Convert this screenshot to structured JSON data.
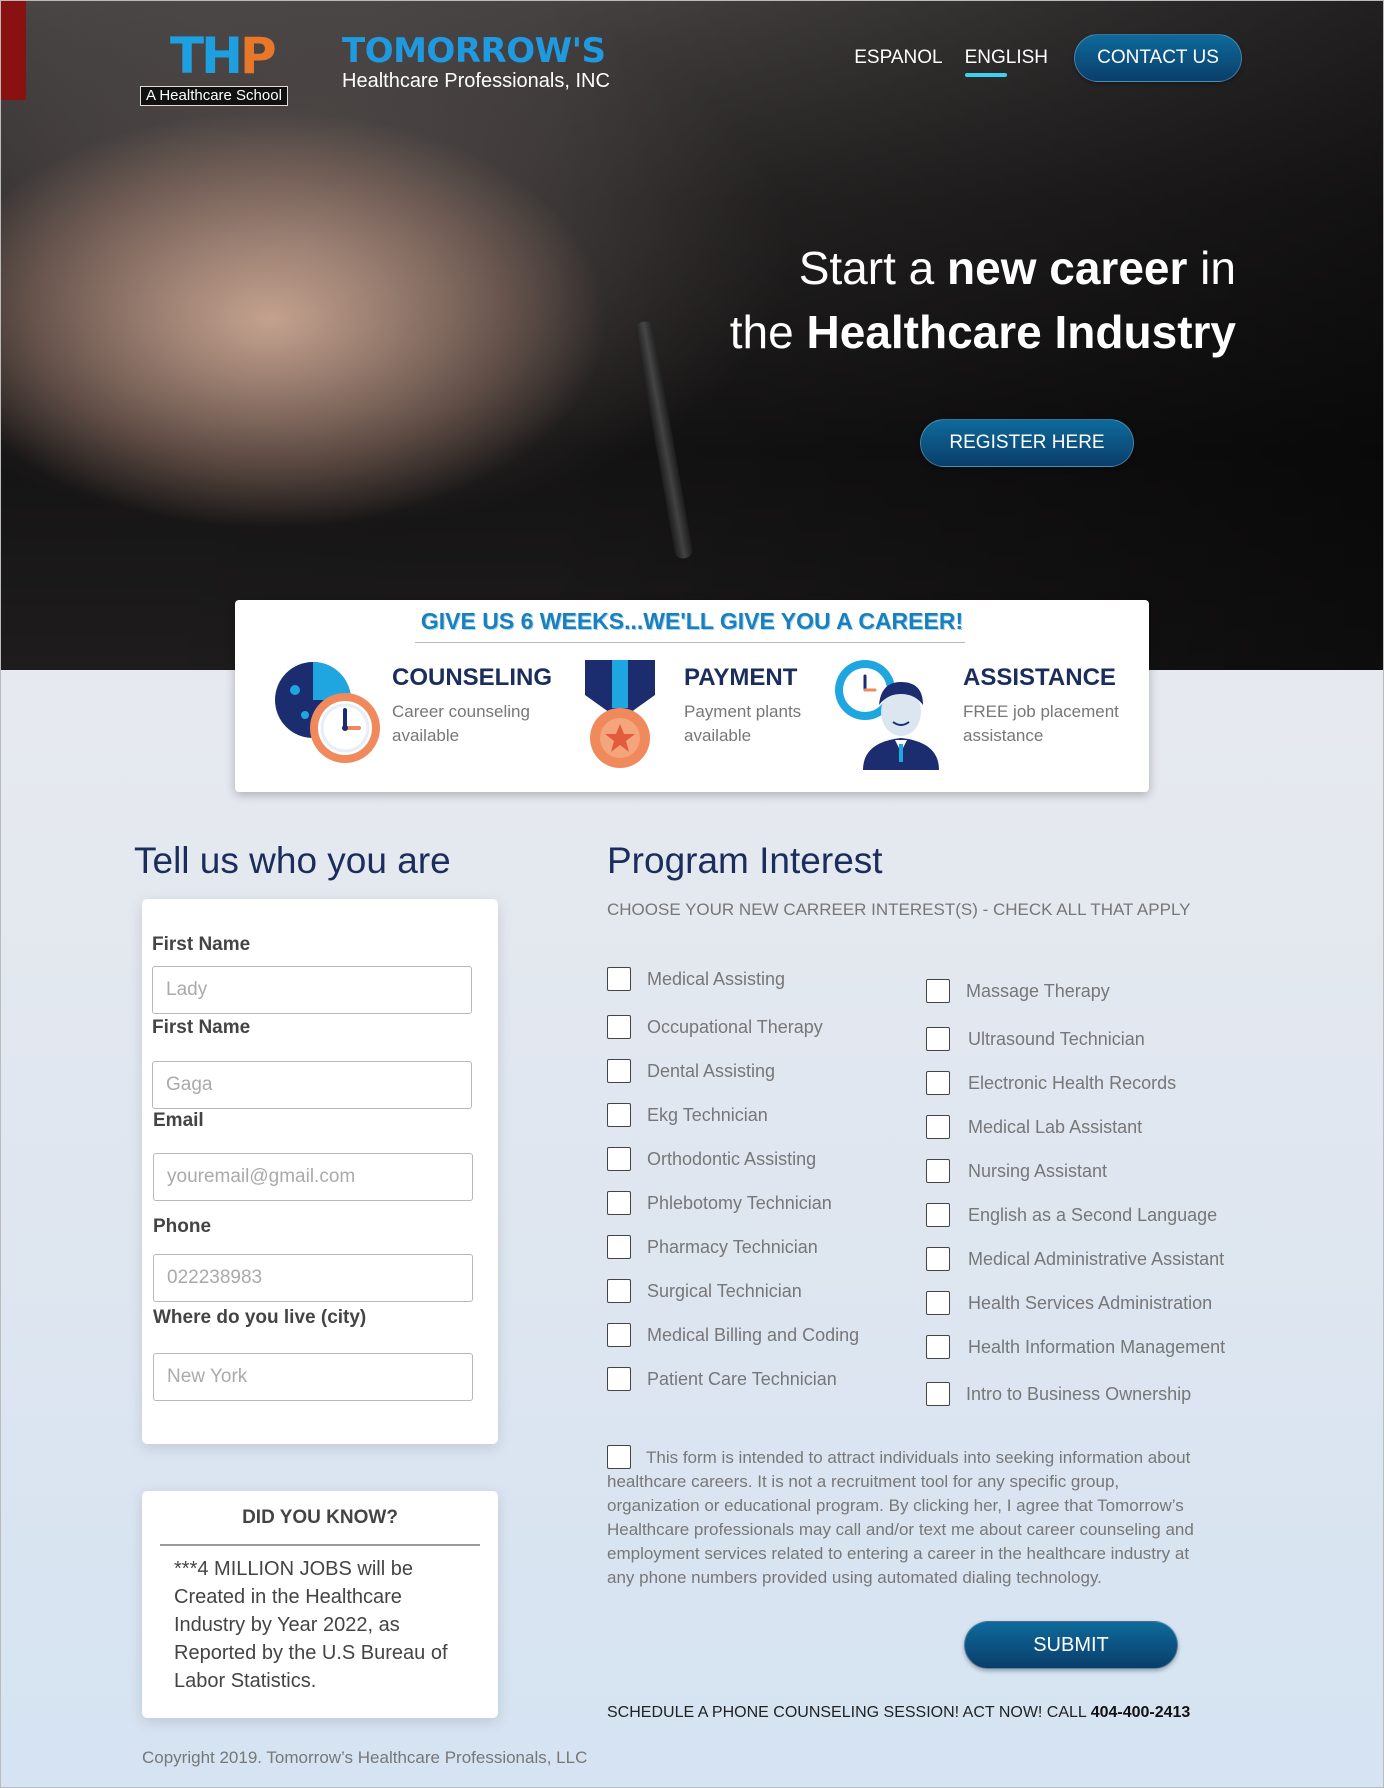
{
  "header": {
    "logo_text": "THP",
    "logo_tagline": "A Healthcare School",
    "brand_name": "TOMORROW'S",
    "brand_sub": "Healthcare Professionals, INC",
    "nav": {
      "espanol": "ESPANOL",
      "english": "ENGLISH",
      "contact": "CONTACT US"
    }
  },
  "hero": {
    "line1_a": "Start a ",
    "line1_b": "new career",
    "line1_c": " in",
    "line2_a": "the ",
    "line2_b": "Healthcare Industry",
    "register": "REGISTER HERE"
  },
  "features": {
    "tagline": "GIVE US 6 WEEKS...WE'LL GIVE YOU A CAREER!",
    "items": [
      {
        "title": "COUNSELING",
        "desc": "Career counseling available",
        "icon": "clock-counseling-icon"
      },
      {
        "title": "PAYMENT",
        "desc": "Payment plants available",
        "icon": "medal-icon"
      },
      {
        "title": "ASSISTANCE",
        "desc": "FREE job placement assistance",
        "icon": "support-agent-icon"
      }
    ]
  },
  "form": {
    "heading": "Tell us who you are",
    "fields": [
      {
        "label": "First Name",
        "placeholder": "Lady"
      },
      {
        "label": "First Name",
        "placeholder": "Gaga"
      },
      {
        "label": "Email",
        "placeholder": "youremail@gmail.com"
      },
      {
        "label": "Phone",
        "placeholder": "022238983"
      },
      {
        "label": "Where do you live (city)",
        "placeholder": "New York"
      }
    ]
  },
  "did_you_know": {
    "heading": "DID YOU KNOW?",
    "text": "***4 MILLION JOBS will be Created in the Healthcare Industry by Year 2022, as Reported by the U.S Bureau of Labor Statistics."
  },
  "program": {
    "heading": "Program Interest",
    "subheading": "CHOOSE YOUR NEW CARREER INTEREST(S) - CHECK ALL THAT APPLY",
    "left": [
      "Medical Assisting",
      "Occupational Therapy",
      "Dental Assisting",
      "Ekg Technician",
      "Orthodontic Assisting",
      "Phlebotomy Technician",
      "Pharmacy Technician",
      "Surgical Technician",
      "Medical Billing and Coding",
      "Patient Care Technician"
    ],
    "right": [
      "Massage Therapy",
      "Ultrasound Technician",
      "Electronic Health Records",
      "Medical Lab Assistant",
      "Nursing Assistant",
      "English as a Second Language",
      "Medical Administrative Assistant",
      "Health Services Administration",
      "Health Information Management",
      "Intro to Business Ownership"
    ],
    "consent": "This form is intended to attract individuals into seeking information about healthcare careers. It is not a recruitment tool for any specific group, organization or educational program. By clicking her, I agree that Tomorrow’s Healthcare professionals may call and/or text me about career counseling and employment services related to entering a career in the healthcare industry at any phone numbers provided using automated dialing technology.",
    "submit": "SUBMIT",
    "schedule_text": "SCHEDULE A PHONE COUNSELING SESSION! ACT NOW! CALL ",
    "phone": "404-400-2413"
  },
  "footer": {
    "copyright": "Copyright 2019. Tomorrow’s Healthcare Professionals, LLC"
  },
  "colors": {
    "brand_blue": "#1f9ae0",
    "brand_orange": "#e9772a",
    "navy": "#1b2d5c",
    "button": "#0a3e6a",
    "accent_cyan": "#3fd0f0"
  }
}
